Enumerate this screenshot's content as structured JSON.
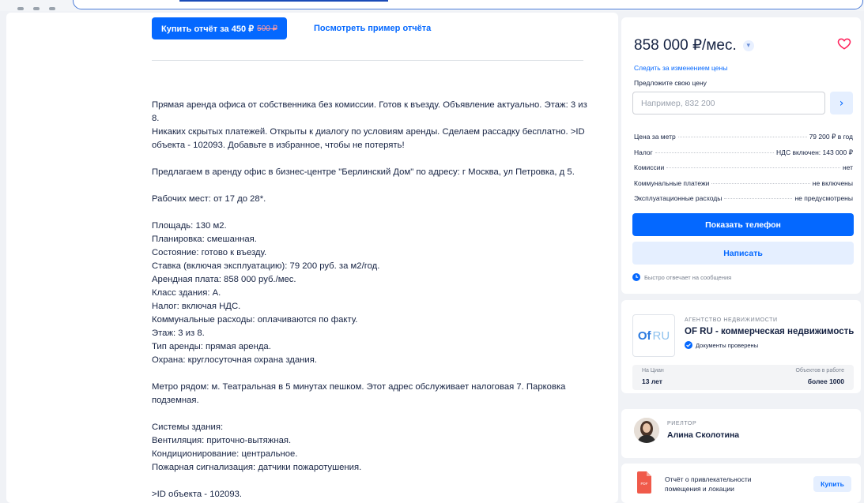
{
  "report": {
    "buy_label": "Купить отчёт за 450 ₽",
    "old_price": "500 ₽",
    "sample_link": "Посмотреть пример отчёта"
  },
  "description": {
    "paragraphs": [
      [
        "Прямая аренда офиса от собственника без комиссии. Готов к въезду. Объявление актуально. Этаж: 3 из 8.",
        "Никаких скрытых платежей. Открыты к диалогу по условиям аренды. Сделаем рассадку бесплатно. >ID объекта - 102093. Добавьте в избранное, чтобы не потерять!"
      ],
      [
        "Предлагаем в аренду офис в бизнес-центре \"Берлинский Дом\" по адресу: г Москва, ул Петровка, д 5."
      ],
      [
        "Рабочих мест: от 17 до 28*."
      ],
      [
        "Площадь: 130 м2.",
        "Планировка: смешанная.",
        "Состояние: готово к въезду.",
        "Ставка (включая эксплуатацию): 79 200 руб. за м2/год.",
        "Арендная плата: 858 000 руб./мес.",
        "Класс здания: А.",
        "Налог: включая НДС.",
        "Коммунальные расходы: оплачиваются по факту.",
        "Этаж: 3 из 8.",
        "Тип аренды: прямая аренда.",
        "Охрана: круглосуточная охрана здания."
      ],
      [
        "Метро рядом: м. Театральная в 5 минутах пешком. Этот адрес обслуживает налоговая 7. Парковка подземная."
      ],
      [
        "Системы здания:",
        "Вентиляция: приточно-вытяжная.",
        "Кондиционирование: центральное.",
        "Пожарная сигнализация: датчики пожаротушения."
      ],
      [
        ">ID объекта - 102093."
      ]
    ]
  },
  "price": {
    "title": "858 000 ₽/мес.",
    "track_link": "Следить за изменением цены",
    "offer_label": "Предложите свою цену",
    "offer_placeholder": "Например, 832 200",
    "go_icon": "›"
  },
  "facts": [
    {
      "label": "Цена за метр",
      "value": "79 200 ₽ в год"
    },
    {
      "label": "Налог",
      "value": "НДС включен: 143 000 ₽"
    },
    {
      "label": "Комиссии",
      "value": "нет"
    },
    {
      "label": "Коммунальные платежи",
      "value": "не включены"
    },
    {
      "label": "Эксплуатационные расходы",
      "value": "не предусмотрены"
    }
  ],
  "actions": {
    "show_phone": "Показать телефон",
    "write": "Написать",
    "fast_reply": "Быстро отвечает на сообщения"
  },
  "agency": {
    "logo_of": "Of",
    "logo_ru": "RU",
    "tag": "АГЕНТСТВО НЕДВИЖИМОСТИ",
    "name": "OF RU - коммерческая недвижимость",
    "verified": "Документы проверены",
    "stat_left_label": "На Циан",
    "stat_left_value": "13 лет",
    "stat_right_label": "Объектов в работе",
    "stat_right_value": "более 1000"
  },
  "realtor": {
    "tag": "РИЕЛТОР",
    "name": "Алина Сколотина"
  },
  "report_card": {
    "text": "Отчёт о привлекательности помещения и локации",
    "buy": "Купить",
    "pdf_label": "PDF"
  },
  "colors": {
    "accent": "#0468ff",
    "accent_light": "#e5efff",
    "heart": "#ff1f5a"
  }
}
